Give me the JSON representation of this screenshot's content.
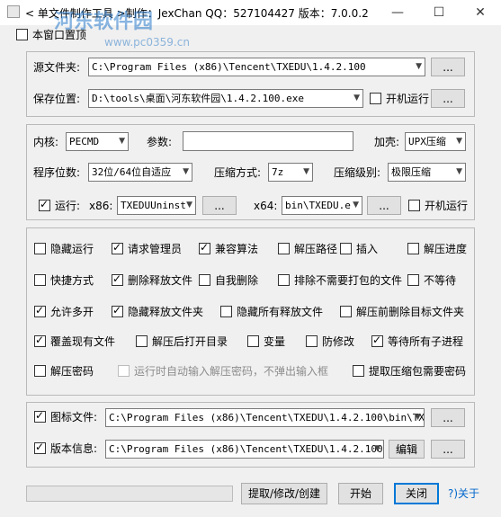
{
  "window": {
    "title": "< 单文件制作工具 >制作：JexChan  QQ：527104427  版本：7.0.0.2",
    "minimize": "—",
    "maximize": "☐",
    "close": "✕"
  },
  "watermark": {
    "brand": "河东软件园",
    "url": "www.pc0359.cn"
  },
  "top_checkbox": {
    "label": "本窗口置顶",
    "checked": false
  },
  "files": {
    "source_label": "源文件夹:",
    "source_value": "C:\\Program Files (x86)\\Tencent\\TXEDU\\1.4.2.100",
    "browse": "...",
    "save_label": "保存位置:",
    "save_value": "D:\\tools\\桌面\\河东软件园\\1.4.2.100.exe",
    "startup_label": "开机运行",
    "startup_checked": false
  },
  "settings": {
    "kernel_label": "内核:",
    "kernel_value": "PECMD",
    "params_label": "参数:",
    "params_value": "",
    "shell_label": "加壳:",
    "shell_value": "UPX压缩",
    "bits_label": "程序位数:",
    "bits_value": "32位/64位自适应",
    "method_label": "压缩方式:",
    "method_value": "7z",
    "level_label": "压缩级别:",
    "level_value": "极限压缩",
    "run_label": "运行:",
    "run_checked": true,
    "x86_label": "x86:",
    "x86_value": "TXEDUUninst",
    "x64_label": "x64:",
    "x64_value": "bin\\TXEDU.e",
    "startup_label": "开机运行",
    "startup_checked": false
  },
  "options": [
    {
      "label": "隐藏运行",
      "checked": false
    },
    {
      "label": "请求管理员",
      "checked": true
    },
    {
      "label": "兼容算法",
      "checked": true
    },
    {
      "label": "解压路径",
      "checked": false
    },
    {
      "label": "插入",
      "checked": false
    },
    {
      "label": "解压进度",
      "checked": false
    },
    {
      "label": "快捷方式",
      "checked": false
    },
    {
      "label": "删除释放文件",
      "checked": true
    },
    {
      "label": "自我删除",
      "checked": false
    },
    {
      "label": "排除不需要打包的文件",
      "checked": false
    },
    {
      "label": "不等待",
      "checked": false
    },
    {
      "label": "允许多开",
      "checked": true
    },
    {
      "label": "隐藏释放文件夹",
      "checked": true
    },
    {
      "label": "隐藏所有释放文件",
      "checked": false
    },
    {
      "label": "解压前删除目标文件夹",
      "checked": false
    },
    {
      "label": "覆盖现有文件",
      "checked": true
    },
    {
      "label": "解压后打开目录",
      "checked": false
    },
    {
      "label": "变量",
      "checked": false
    },
    {
      "label": "防修改",
      "checked": false
    },
    {
      "label": "等待所有子进程",
      "checked": true
    },
    {
      "label": "解压密码",
      "checked": false
    },
    {
      "label": "运行时自动输入解压密码，不弹出输入框",
      "checked": false,
      "disabled": true
    },
    {
      "label": "提取压缩包需要密码",
      "checked": false
    }
  ],
  "resources": {
    "icon_label": "图标文件:",
    "icon_checked": true,
    "icon_value": "C:\\Program Files (x86)\\Tencent\\TXEDU\\1.4.2.100\\bin\\TXEDU",
    "version_label": "版本信息:",
    "version_checked": true,
    "version_value": "C:\\Program Files (x86)\\Tencent\\TXEDU\\1.4.2.100\\b",
    "edit_label": "编辑",
    "browse": "..."
  },
  "footer": {
    "extract_label": "提取/修改/创建",
    "start_label": "开始",
    "close_label": "关闭",
    "about_label": "?)关于"
  }
}
